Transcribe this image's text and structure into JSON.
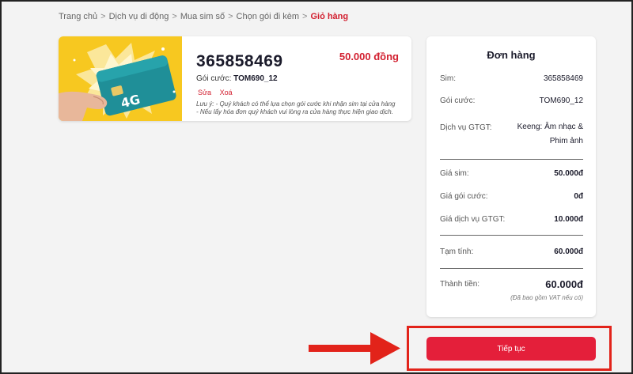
{
  "breadcrumb": {
    "items": [
      "Trang chủ",
      "Dịch vụ di động",
      "Mua sim số",
      "Chọn gói đi kèm"
    ],
    "current": "Giỏ hàng",
    "separator": ">"
  },
  "product": {
    "sim_number": "365858469",
    "price": "50.000 đồng",
    "package_label": "Gói cước:",
    "package_value": "TOM690_12",
    "edit_label": "Sửa",
    "delete_label": "Xoá",
    "note_line1": "Lưu ý: - Quý khách có thể lựa chọn gói cước khi nhận sim tại cửa hàng",
    "note_line2": "- Nếu lấy hóa đơn quý khách vui lòng ra cửa hàng thực hiện giao dịch.",
    "thumb_badge": "4G"
  },
  "order": {
    "title": "Đơn hàng",
    "sim_label": "Sim:",
    "sim_value": "365858469",
    "package_label": "Gói cước:",
    "package_value": "TOM690_12",
    "vas_label": "Dịch vụ GTGT:",
    "vas_value_line1": "Keeng: Âm nhạc &",
    "vas_value_line2": "Phim ảnh",
    "sim_price_label": "Giá sim:",
    "sim_price_value": "50.000đ",
    "package_price_label": "Giá gói cước:",
    "package_price_value": "0đ",
    "vas_price_label": "Giá dịch vụ GTGT:",
    "vas_price_value": "10.000đ",
    "subtotal_label": "Tạm tính:",
    "subtotal_value": "60.000đ",
    "total_label": "Thành tiền:",
    "total_value": "60.000đ",
    "vat_note": "(Đã bao gồm VAT nếu có)"
  },
  "continue_button": {
    "label": "Tiếp tục"
  },
  "colors": {
    "accent": "#d21f2f",
    "button": "#e41f3a",
    "highlight": "#e2231a"
  }
}
